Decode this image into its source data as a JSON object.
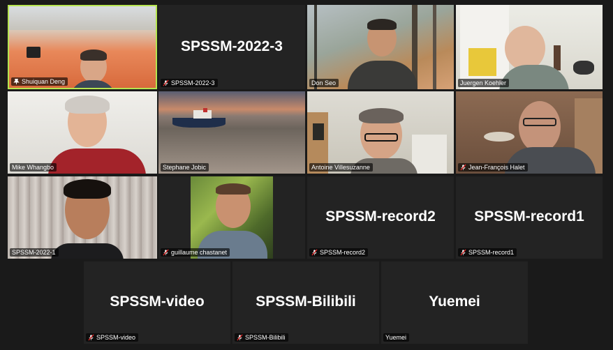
{
  "colors": {
    "background": "#1a1a1a",
    "tile_background": "#232323",
    "active_speaker_border": "#b5e550",
    "mic_muted": "#e02828"
  },
  "participants": [
    {
      "name": "Shuiquan Deng",
      "muted": false,
      "video": true,
      "active_speaker": true
    },
    {
      "name": "SPSSM-2022-3",
      "muted": true,
      "video": false,
      "display_name": "SPSSM-2022-3"
    },
    {
      "name": "Don Seo",
      "muted": false,
      "video": true
    },
    {
      "name": "Juergen Koehler",
      "muted": false,
      "video": true
    },
    {
      "name": "Mike Whangbo",
      "muted": false,
      "video": true
    },
    {
      "name": "Stephane Jobic",
      "muted": false,
      "video": true
    },
    {
      "name": "Antoine Villesuzanne",
      "muted": false,
      "video": true
    },
    {
      "name": "Jean-François Halet",
      "muted": true,
      "video": true
    },
    {
      "name": "SPSSM-2022-1",
      "muted": false,
      "video": true
    },
    {
      "name": "guillaume chastanet",
      "muted": true,
      "video": true
    },
    {
      "name": "SPSSM-record2",
      "muted": true,
      "video": false,
      "display_name": "SPSSM-record2"
    },
    {
      "name": "SPSSM-record1",
      "muted": true,
      "video": false,
      "display_name": "SPSSM-record1"
    },
    {
      "name": "SPSSM-video",
      "muted": true,
      "video": false,
      "display_name": "SPSSM-video"
    },
    {
      "name": "SPSSM-Bilibili",
      "muted": true,
      "video": false,
      "display_name": "SPSSM-Bilibili"
    },
    {
      "name": "Yuemei",
      "muted": false,
      "video": false,
      "display_name": "Yuemei"
    }
  ]
}
